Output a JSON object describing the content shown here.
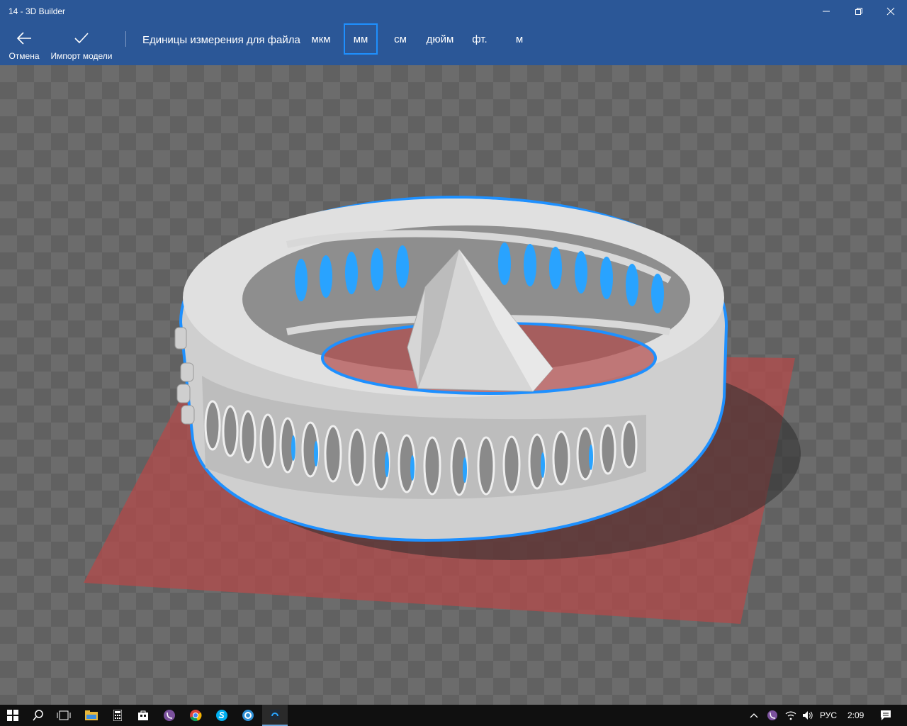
{
  "window": {
    "title": "14 - 3D Builder"
  },
  "toolbar": {
    "cancel_label": "Отмена",
    "import_label": "Импорт модели",
    "units_label": "Единицы измерения для файла",
    "units": [
      "мкм",
      "мм",
      "см",
      "дюйм",
      "фт.",
      "м"
    ],
    "selected_unit": "мм"
  },
  "colors": {
    "accent_bar": "#2b5797",
    "selection_outline": "#1e90ff",
    "build_plate": "#b04a4a",
    "model": "#d9d9d9"
  },
  "viewport": {
    "model_icon": "ring-with-gem-model"
  },
  "taskbar": {
    "language": "РУС",
    "time": "2:09"
  }
}
